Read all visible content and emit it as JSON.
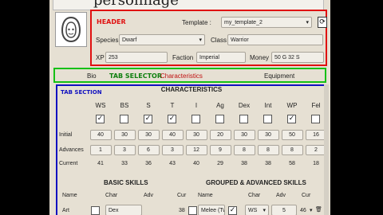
{
  "title": "personnage",
  "header": {
    "label": "HEADER",
    "template_label": "Template :",
    "template_value": "my_template_2",
    "species_label": "Species",
    "species_value": "Dwarf",
    "class_label": "Class",
    "class_value": "Warrior",
    "xp_label": "XP",
    "xp_value": "253",
    "faction_label": "Faction",
    "faction_value": "Imperial",
    "money_label": "Money",
    "money_value": "50 G 32 S"
  },
  "tabs": {
    "selector_label": "TAB SELECTOR",
    "bio": "Bio",
    "characteristics": "Characteristics",
    "equipment": "Equipment",
    "active_color": "#c01010"
  },
  "tab_section": {
    "label": "TAB SECTION",
    "title": "CHARACTERISTICS",
    "columns": [
      "WS",
      "BS",
      "S",
      "T",
      "I",
      "Ag",
      "Dex",
      "Int",
      "WP",
      "Fel"
    ],
    "checked": [
      true,
      false,
      true,
      true,
      false,
      false,
      false,
      false,
      true,
      false
    ],
    "row_labels": {
      "initial": "Initial",
      "advances": "Advances",
      "current": "Current"
    },
    "initial": [
      "40",
      "30",
      "30",
      "40",
      "30",
      "20",
      "30",
      "30",
      "50",
      "16"
    ],
    "advances": [
      "1",
      "3",
      "6",
      "3",
      "12",
      "9",
      "8",
      "8",
      "8",
      "2"
    ],
    "current": [
      "41",
      "33",
      "36",
      "43",
      "40",
      "29",
      "38",
      "38",
      "58",
      "18"
    ]
  },
  "skills": {
    "basic_title": "BASIC SKILLS",
    "grouped_title": "GROUPED & ADVANCED SKILLS",
    "headers": {
      "name": "Name",
      "char": "Char",
      "adv": "Adv",
      "cur": "Cur"
    },
    "basic_row": {
      "name": "Art",
      "char": "Dex",
      "cur": "38"
    },
    "grouped_row": {
      "name": "Melee (Tw",
      "char": "WS",
      "adv": "5",
      "cur": "46"
    }
  }
}
